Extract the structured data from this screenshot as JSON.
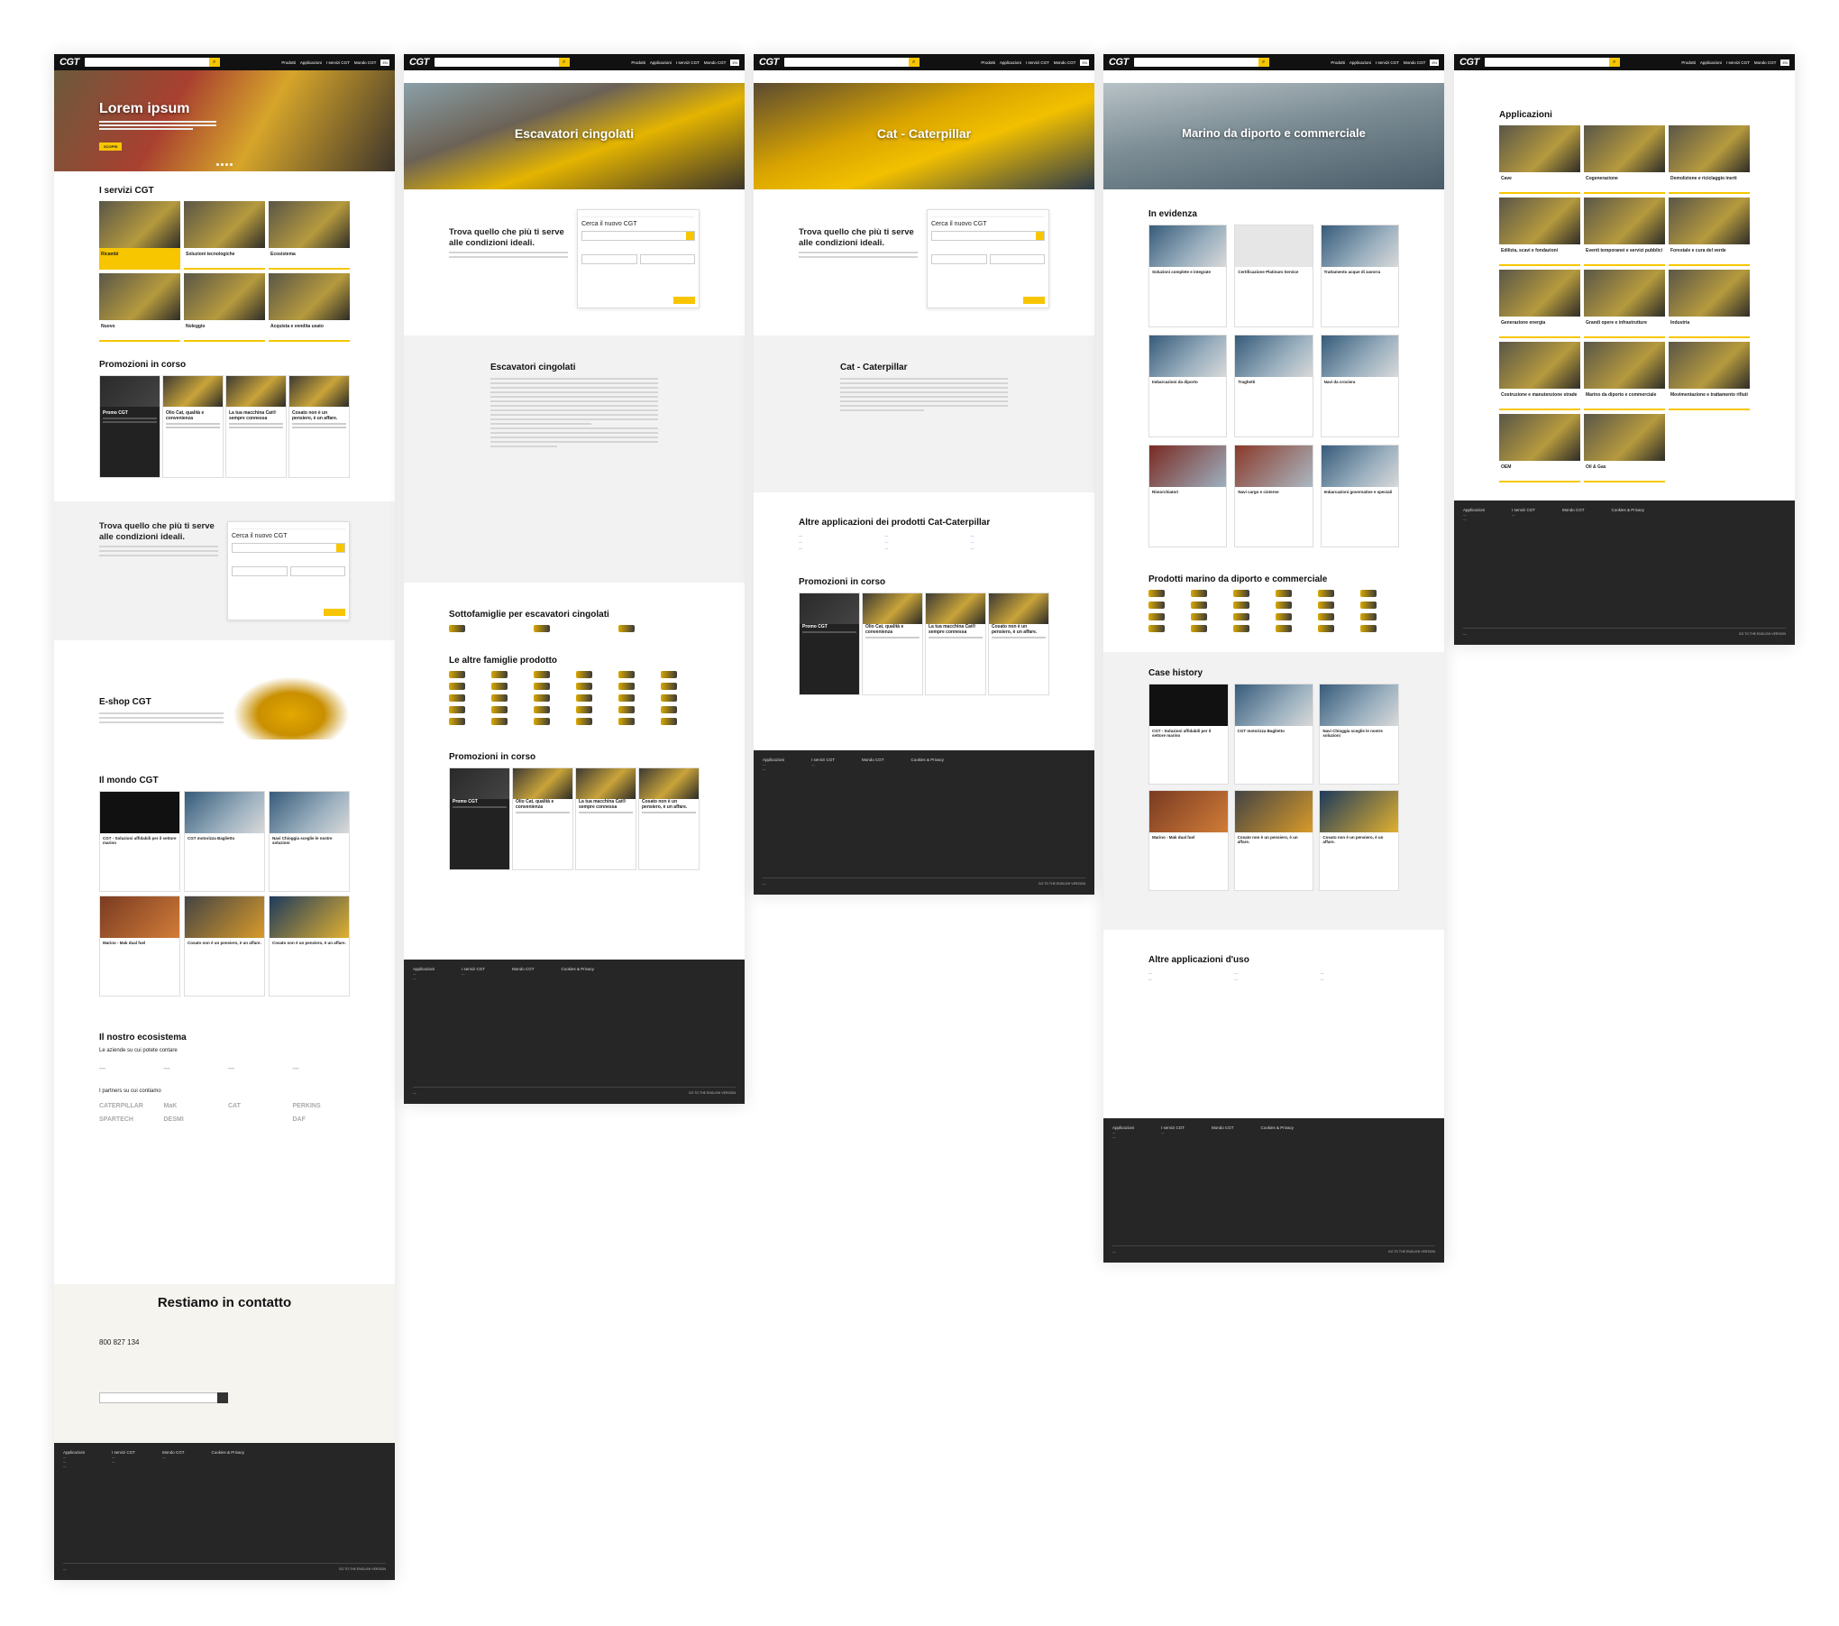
{
  "header": {
    "logo": "CGT",
    "nav": [
      "Prodotti",
      "Applicazioni",
      "I servizi CGT",
      "Mondo CGT"
    ],
    "lang": "EN"
  },
  "pages": [
    {
      "hero_title": "Lorem ipsum",
      "hero_button": "SCOPRI",
      "services_title": "I servizi CGT",
      "services": [
        "Ricambi",
        "Soluzioni tecnologiche",
        "Ecosistema",
        "Nuovo",
        "Noleggio",
        "Acquista e vendita usato"
      ],
      "promos_title": "Promozioni in corso",
      "promos": [
        {
          "tag": "",
          "title": "Promo CGT"
        },
        {
          "tag": "",
          "title": "Olio Cat, qualità e convenienza"
        },
        {
          "tag": "",
          "title": "La tua macchina Cat® sempre connessa"
        },
        {
          "tag": "",
          "title": "Cosato non è un pensiero, è un affare."
        }
      ],
      "finder_title": "Trova quello che più ti serve alle condizioni ideali.",
      "finder_card_title": "Cerca il nuovo CGT",
      "eshop_title": "E-shop CGT",
      "world_title": "Il mondo CGT",
      "world_cards": [
        "CGT - Soluzioni affidabili per il settore marino",
        "CGT motorizza Baglietto",
        "Navi Chioggia sceglie le nostre soluzioni",
        "Marino - Mak dual fuel",
        "Cosato non è un pensiero, è un affare.",
        "Cosato non è un pensiero, è un affare."
      ],
      "ecosystem_title": "Il nostro ecosistema",
      "ecosystem_sub": "Le aziende su cui potete contare",
      "partners_sub": "I partners su cui contiamo",
      "partner_logos": [
        "CATERPILLAR",
        "MaK",
        "CAT",
        "PERKINS",
        "SPARTECH",
        "DESMI",
        "",
        "DAF"
      ],
      "contact_title": "Restiamo in contatto",
      "phone": "800 827 134"
    },
    {
      "hero_title": "Escavatori cingolati",
      "finder_title": "Trova quello che più ti serve alle condizioni ideali.",
      "finder_card_title": "Cerca il nuovo CGT",
      "body_title": "Escavatori cingolati",
      "subfam_title": "Sottofamiglie per escavatori cingolati",
      "families_title": "Le altre famiglie prodotto",
      "promos_title": "Promozioni in corso"
    },
    {
      "hero_title": "Cat - Caterpillar",
      "finder_title": "Trova quello che più ti serve alle condizioni ideali.",
      "finder_card_title": "Cerca il nuovo CGT",
      "body_title": "Cat - Caterpillar",
      "apps_title": "Altre applicazioni dei prodotti Cat-Caterpillar",
      "promos_title": "Promozioni in corso"
    },
    {
      "hero_title": "Marino da diporto e commerciale",
      "featured_title": "In evidenza",
      "featured": [
        "Soluzioni complete e integrate",
        "Certificazione Platinum Service",
        "Trattamento acque di zavorra",
        "Imbarcazioni da diporto",
        "Traghetti",
        "Navi da crociera",
        "Rimorchiatori",
        "Navi cargo e cisterne",
        "Imbarcazioni governative e speciali"
      ],
      "products_title": "Prodotti marino da diporto e commerciale",
      "case_title": "Case history",
      "cases": [
        "CGT - Soluzioni affidabili per il settore marino",
        "CGT motorizza Baglietto",
        "Navi Chioggia sceglie le nostre soluzioni",
        "Marino - Mak dual fuel",
        "Cosato non è un pensiero, è un affare.",
        "Cosato non è un pensiero, è un affare."
      ],
      "other_apps_title": "Altre applicazioni d'uso"
    },
    {
      "apps_title": "Applicazioni",
      "apps": [
        "Cave",
        "Cogenerazione",
        "Demolizione e riciclaggio inerti",
        "Edilizia, scavi e fondazioni",
        "Eventi temporanei e servizi pubblici",
        "Forestale e cura del verde",
        "Generazione energia",
        "Grandi opere e infrastrutture",
        "Industria",
        "Costruzione e manutenzione strade",
        "Marino da diporto e commerciale",
        "Movimentazione e trattamento rifiuti",
        "OEM",
        "Oil & Gas",
        ""
      ]
    }
  ],
  "footer": {
    "cols": [
      "Applicazioni",
      "I servizi CGT",
      "Mondo CGT",
      "Cookies & Privacy"
    ],
    "cta": "GO TO THE ENGLISH VERSION"
  }
}
